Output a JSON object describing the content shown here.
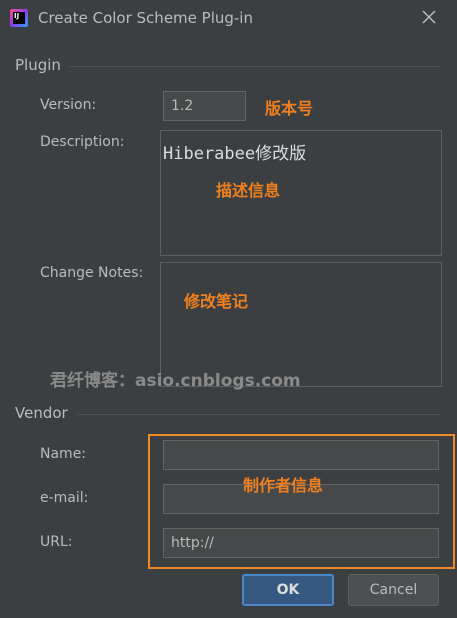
{
  "window": {
    "title": "Create Color Scheme Plug-in",
    "app_icon_text": "IJ"
  },
  "plugin": {
    "section_label": "Plugin",
    "version_label": "Version:",
    "version_value": "1.2",
    "description_label": "Description:",
    "description_value": "Hiberabee修改版",
    "change_notes_label": "Change Notes:",
    "change_notes_value": ""
  },
  "vendor": {
    "section_label": "Vendor",
    "name_label": "Name:",
    "name_value": "",
    "email_label": "e-mail:",
    "email_value": "",
    "url_label": "URL:",
    "url_value": "http://"
  },
  "annotations": {
    "version": "版本号",
    "description": "描述信息",
    "change_notes": "修改笔记",
    "vendor": "制作者信息",
    "watermark": "君纤博客：asio.cnblogs.com"
  },
  "buttons": {
    "ok": "OK",
    "cancel": "Cancel"
  },
  "colors": {
    "background": "#3c3f41",
    "annotation": "#f07f1f",
    "ok_button": "#365880"
  }
}
